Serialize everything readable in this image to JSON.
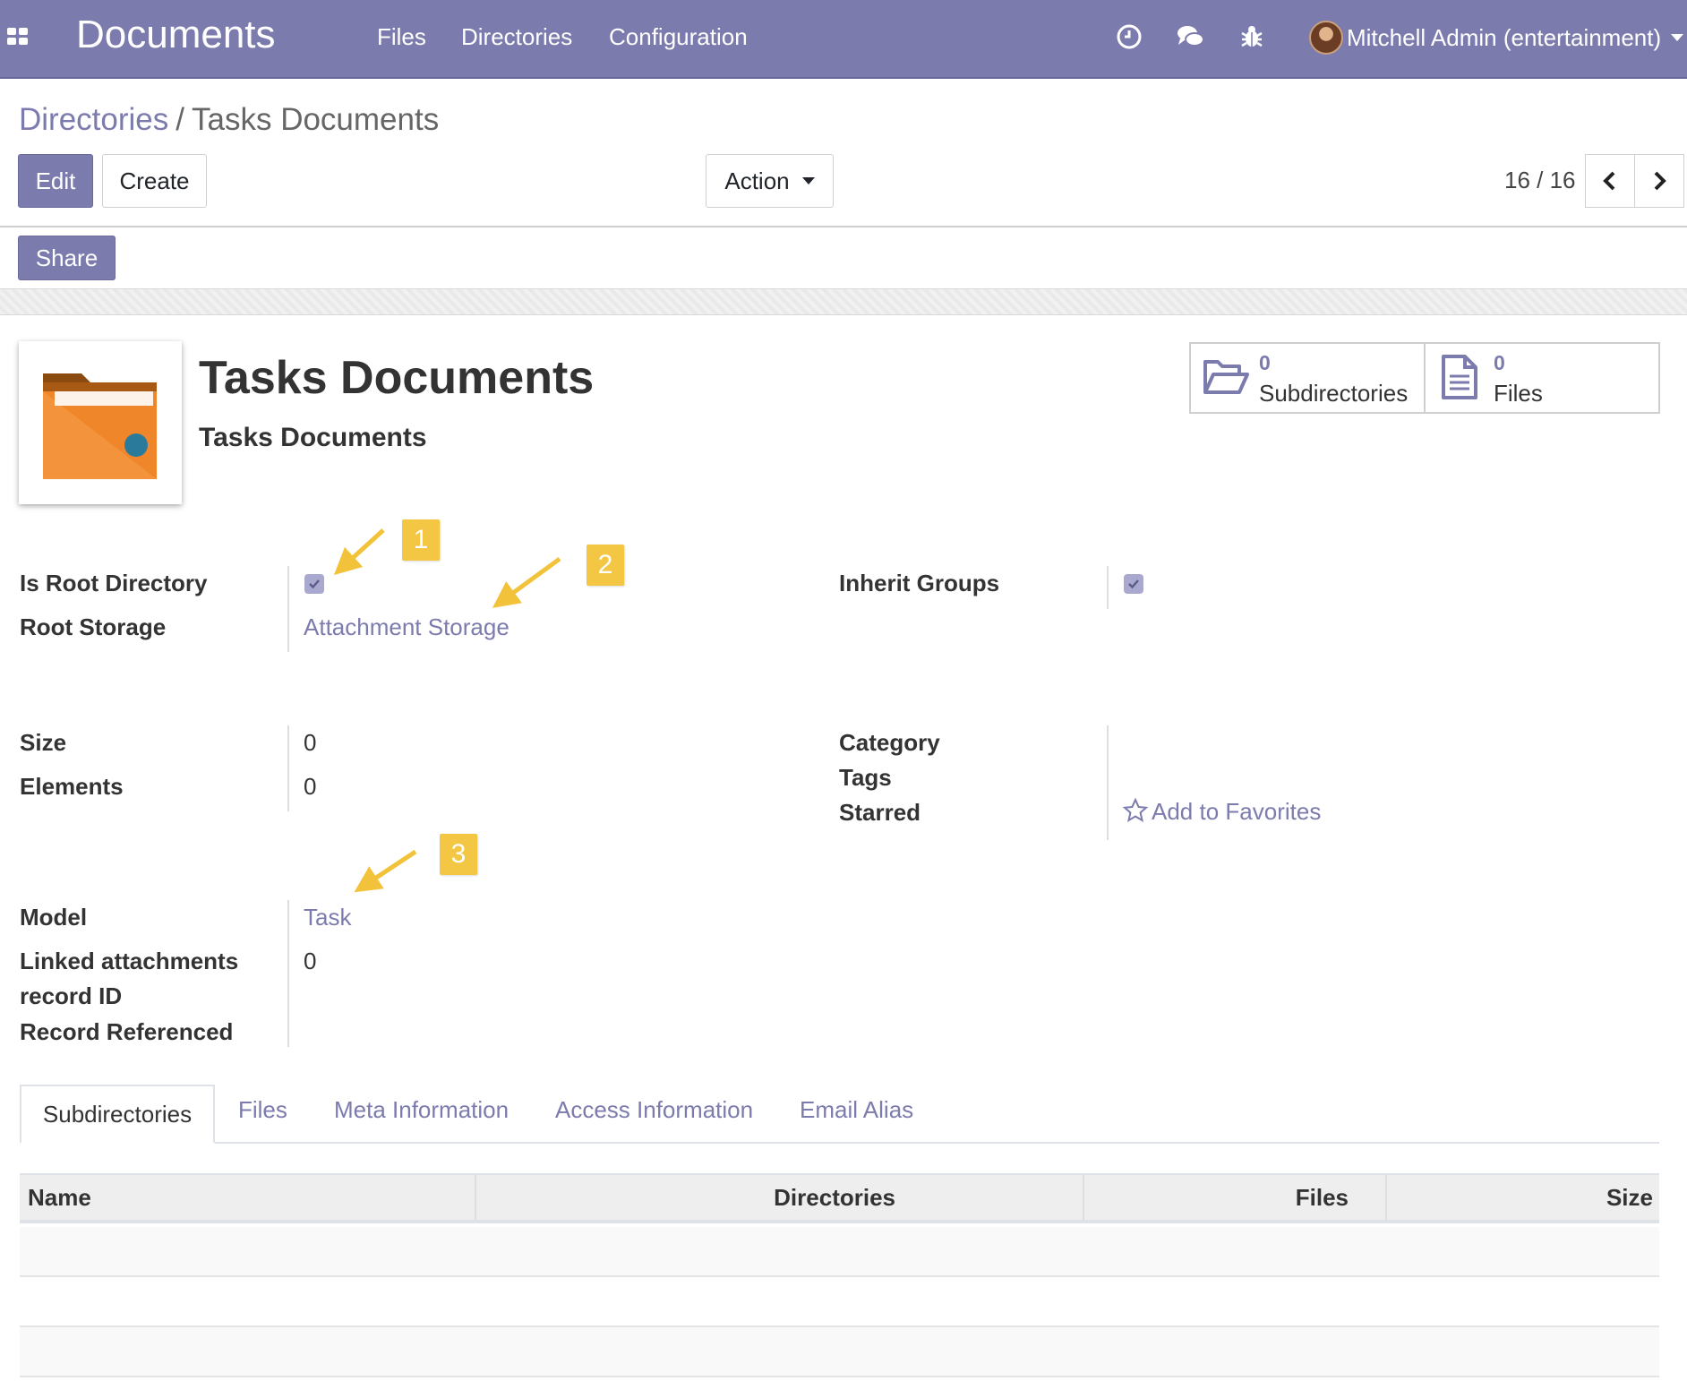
{
  "navbar": {
    "brand": "Documents",
    "menus": [
      "Files",
      "Directories",
      "Configuration"
    ],
    "user_name": "Mitchell Admin (entertainment)",
    "icons": [
      "apps-grid-icon",
      "clock-icon",
      "chat-icon",
      "bug-icon"
    ]
  },
  "breadcrumb": {
    "parent": "Directories",
    "separator": "/",
    "current": "Tasks Documents"
  },
  "toolbar": {
    "edit_label": "Edit",
    "create_label": "Create",
    "action_label": "Action",
    "share_label": "Share"
  },
  "pager": {
    "value": "16 / 16"
  },
  "record": {
    "title": "Tasks Documents",
    "subtitle": "Tasks Documents",
    "stats": [
      {
        "count": "0",
        "label": "Subdirectories",
        "icon": "folder-open-icon"
      },
      {
        "count": "0",
        "label": "Files",
        "icon": "file-text-icon"
      }
    ]
  },
  "fields": {
    "is_root_directory": {
      "label": "Is Root Directory",
      "checked": true
    },
    "root_storage": {
      "label": "Root Storage",
      "value": "Attachment Storage"
    },
    "inherit_groups": {
      "label": "Inherit Groups",
      "checked": true
    },
    "size": {
      "label": "Size",
      "value": "0"
    },
    "elements": {
      "label": "Elements",
      "value": "0"
    },
    "category": {
      "label": "Category",
      "value": ""
    },
    "tags": {
      "label": "Tags",
      "value": ""
    },
    "starred": {
      "label": "Starred",
      "value": "Add to Favorites"
    },
    "model": {
      "label": "Model",
      "value": "Task"
    },
    "linked_attachments": {
      "label_line1": "Linked attachments",
      "label_line2": "record ID",
      "value": "0"
    },
    "record_referenced": {
      "label": "Record Referenced",
      "value": ""
    }
  },
  "annotations": [
    "1",
    "2",
    "3"
  ],
  "tabs": [
    "Subdirectories",
    "Files",
    "Meta Information",
    "Access Information",
    "Email Alias"
  ],
  "table": {
    "columns": [
      "Name",
      "Directories",
      "Files",
      "Size"
    ],
    "rows": []
  },
  "colors": {
    "brand": "#7c7bad",
    "annotation": "#f3c744",
    "arrow": "#f2c33a",
    "folder": "#f0862a"
  }
}
